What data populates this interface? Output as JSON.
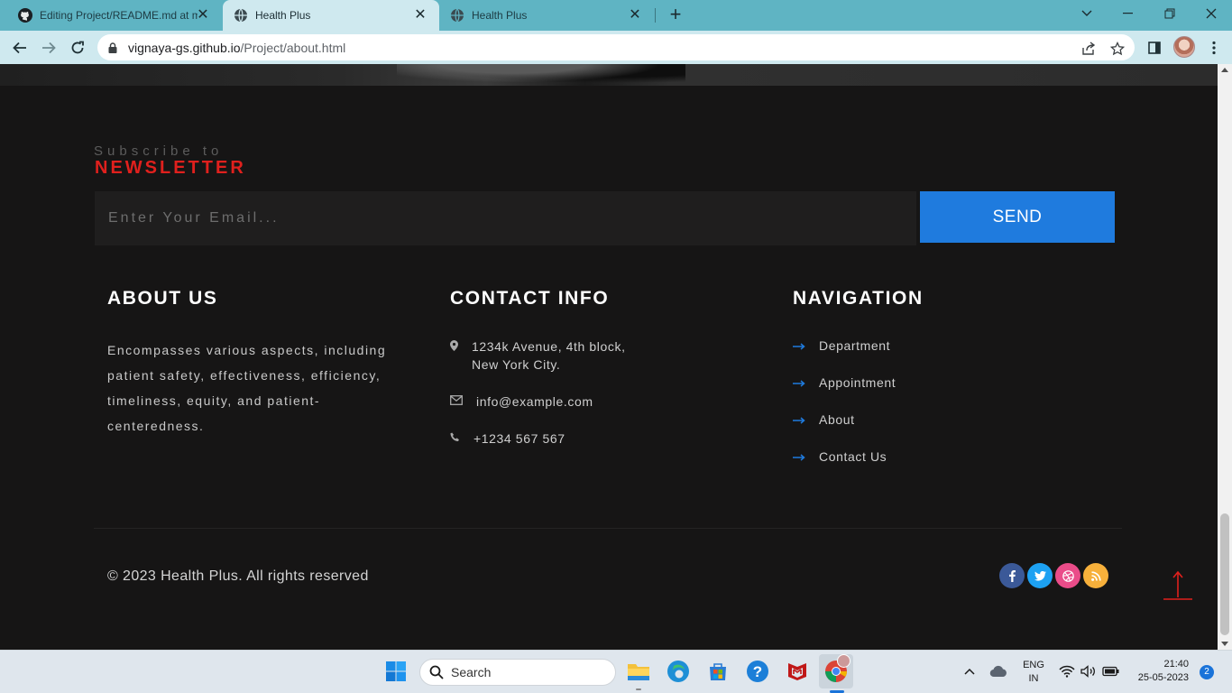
{
  "browser": {
    "tabs": [
      {
        "title": "Editing Project/README.md at m",
        "icon": "github-icon",
        "active": false
      },
      {
        "title": "Health Plus",
        "icon": "globe-icon",
        "active": true
      },
      {
        "title": "Health Plus",
        "icon": "globe-icon",
        "active": false
      }
    ],
    "url_host": "vignaya-gs.github.io",
    "url_path": "/Project/about.html"
  },
  "newsletter": {
    "subtitle": "Subscribe to",
    "title": "NEWSLETTER",
    "email_placeholder": "Enter Your Email...",
    "send_label": "SEND"
  },
  "about": {
    "title": "ABOUT US",
    "text": "Encompasses various aspects, including patient safety, effectiveness, efficiency, timeliness, equity, and patient-centeredness."
  },
  "contact": {
    "title": "CONTACT INFO",
    "address_line1": "1234k Avenue, 4th block,",
    "address_line2": "New York City.",
    "email": "info@example.com",
    "phone": "+1234 567 567"
  },
  "navigation": {
    "title": "NAVIGATION",
    "links": [
      "Department",
      "Appointment",
      "About",
      "Contact Us"
    ]
  },
  "footer": {
    "copyright": "© 2023 Health Plus. All rights reserved",
    "social": [
      "facebook-icon",
      "twitter-icon",
      "dribbble-icon",
      "rss-icon"
    ]
  },
  "taskbar": {
    "search_label": "Search",
    "language": "ENG",
    "region": "IN",
    "time": "21:40",
    "date": "25-05-2023",
    "notification_count": "2"
  },
  "colors": {
    "accent_red": "#e0201d",
    "accent_blue": "#1f7bde",
    "background": "#161515"
  }
}
